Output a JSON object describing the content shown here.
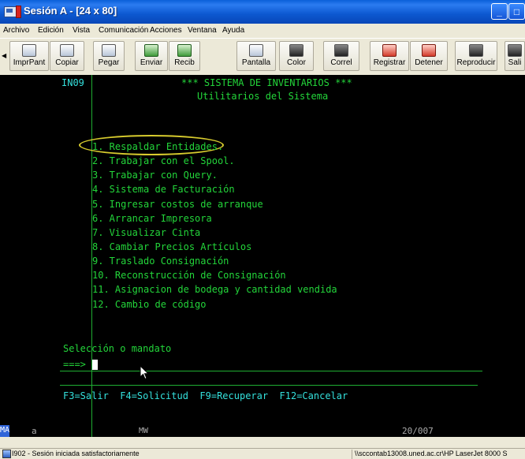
{
  "window": {
    "title": "Sesión A - [24 x 80]",
    "controls": {
      "minimize": "_",
      "maximize": "□"
    }
  },
  "menu": [
    "Archivo",
    "Edición",
    "Vista",
    "Comunicación",
    "Acciones",
    "Ventana",
    "Ayuda"
  ],
  "toolbar": [
    {
      "label": "ImprPant",
      "icon": "print-screen-icon"
    },
    {
      "label": "Copiar",
      "icon": "copy-icon"
    },
    {
      "label": "Pegar",
      "icon": "paste-icon"
    },
    {
      "label": "Enviar",
      "icon": "send-icon"
    },
    {
      "label": "Recib",
      "icon": "receive-icon"
    },
    {
      "label": "Pantalla",
      "icon": "display-icon"
    },
    {
      "label": "Color",
      "icon": "color-icon"
    },
    {
      "label": "Correl",
      "icon": "correl-icon"
    },
    {
      "label": "Registrar",
      "icon": "record-icon"
    },
    {
      "label": "Detener",
      "icon": "stop-icon"
    },
    {
      "label": "Reproducir",
      "icon": "play-icon"
    },
    {
      "label": "Sali",
      "icon": "exit-icon"
    }
  ],
  "terminal": {
    "screen_id": "IN09",
    "title": "*** SISTEMA DE INVENTARIOS ***",
    "subtitle": "Utilitarios del Sistema",
    "menu_options": [
      "1. Respaldar Entidades.",
      "2. Trabajar con el Spool.",
      "3. Trabajar con Query.",
      "4. Sistema de Facturación",
      "5. Ingresar costos de arranque",
      "6. Arrancar Impresora",
      "7. Visualizar Cinta",
      "8. Cambiar Precios Artículos",
      "9. Traslado Consignación",
      "10. Reconstrucción de Consignación",
      "11. Asignacion de bodega y cantidad vendida",
      "12. Cambio de código"
    ],
    "prompt_label": "Selección o mandato",
    "prompt_arrow": "===>",
    "input_value": "",
    "function_keys": "F3=Salir  F4=Solicitud  F9=Recuperar  F12=Cancelar"
  },
  "oia": {
    "left": "MA",
    "session": "a",
    "mw": "MW",
    "cursor_position": "20/007"
  },
  "status": {
    "message": "I902 - Sesión iniciada satisfactoriamente",
    "printer": "\\\\sccontab13008.uned.ac.cr\\HP LaserJet 8000 S"
  },
  "colors": {
    "terminal_bg": "#000000",
    "terminal_green": "#23d53a",
    "terminal_cyan": "#34e0dc",
    "highlight_circle": "#d8cc2e"
  }
}
